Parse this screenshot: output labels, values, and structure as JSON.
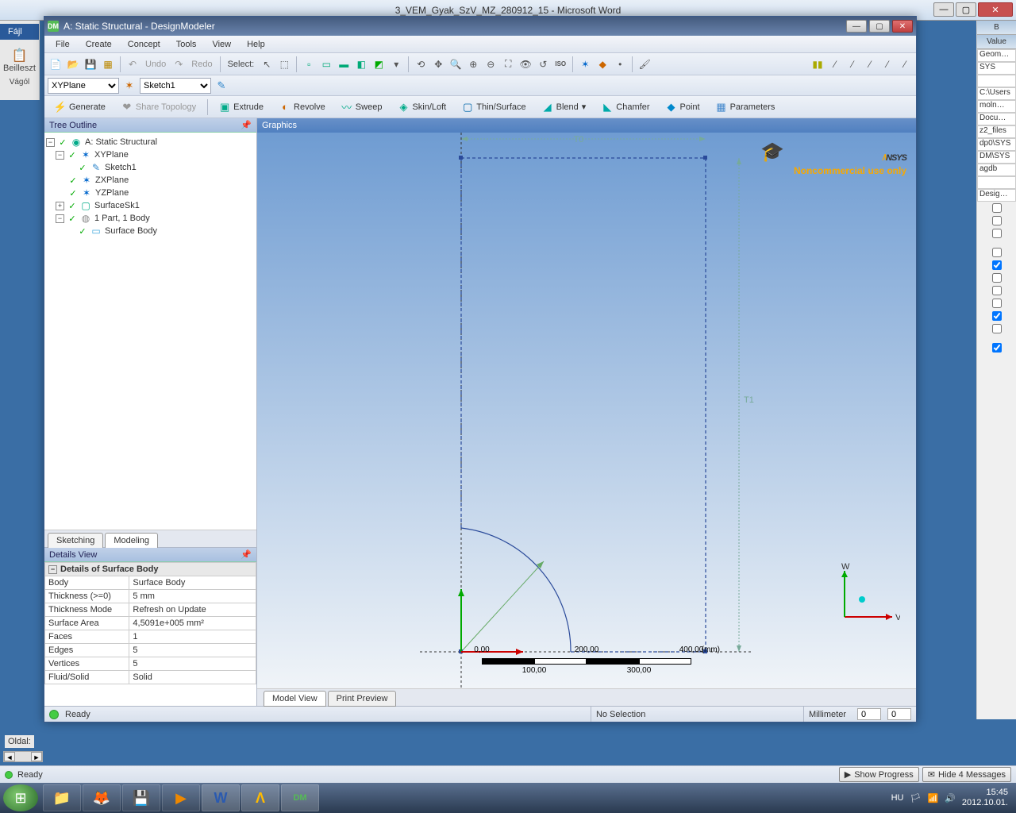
{
  "word": {
    "title": "3_VEM_Gyak_SzV_MZ_280912_15  - Microsoft Word",
    "file_tab": "Fájl",
    "paste": "Beilleszt",
    "vagol": "Vágól",
    "oldal": "Oldal: "
  },
  "wb_right": {
    "colB": "B",
    "value": "Value",
    "rows": [
      "Geom…",
      "SYS",
      "",
      "C:\\Users",
      "moln…",
      "Docu…",
      "z2_files",
      "dp0\\SYS",
      "DM\\SYS",
      "agdb",
      "",
      "Desig…"
    ]
  },
  "dm": {
    "title": "A: Static Structural - DesignModeler",
    "menu": [
      "File",
      "Create",
      "Concept",
      "Tools",
      "View",
      "Help"
    ],
    "toolbar1": {
      "undo": "Undo",
      "redo": "Redo",
      "select": "Select:"
    },
    "toolbar2": {
      "plane": "XYPlane",
      "sketch": "Sketch1"
    },
    "ops": {
      "generate": "Generate",
      "share": "Share Topology",
      "extrude": "Extrude",
      "revolve": "Revolve",
      "sweep": "Sweep",
      "skin": "Skin/Loft",
      "thin": "Thin/Surface",
      "blend": "Blend",
      "chamfer": "Chamfer",
      "point": "Point",
      "params": "Parameters"
    },
    "tree_hd": "Tree Outline",
    "tree": {
      "root": "A: Static Structural",
      "xyplane": "XYPlane",
      "sketch1": "Sketch1",
      "zxplane": "ZXPlane",
      "yzplane": "YZPlane",
      "surfacesk1": "SurfaceSk1",
      "part": "1 Part, 1 Body",
      "surfbody": "Surface Body"
    },
    "tabs": {
      "sketching": "Sketching",
      "modeling": "Modeling"
    },
    "details_hd": "Details View",
    "details": {
      "section": "Details of Surface Body",
      "rows": [
        [
          "Body",
          "Surface Body"
        ],
        [
          "Thickness (>=0)",
          "5 mm"
        ],
        [
          "Thickness Mode",
          "Refresh on Update"
        ],
        [
          "Surface Area",
          "4,5091e+005 mm²"
        ],
        [
          "Faces",
          "1"
        ],
        [
          "Edges",
          "5"
        ],
        [
          "Vertices",
          "5"
        ],
        [
          "Fluid/Solid",
          "Solid"
        ]
      ]
    },
    "graphics_hd": "Graphics",
    "logo_sub": "Noncommercial use only",
    "dim_t0": "T0",
    "dim_t1": "T1",
    "ruler": {
      "t0": "0,00",
      "t200": "200,00",
      "t400": "400,00",
      "b100": "100,00",
      "b300": "300,00",
      "unit": "(mm)"
    },
    "triad": {
      "x": "V",
      "y": "W"
    },
    "bottom_tabs": {
      "model": "Model View",
      "print": "Print Preview"
    },
    "status": {
      "ready": "Ready",
      "nosel": "No Selection",
      "unit": "Millimeter",
      "v1": "0",
      "v2": "0"
    }
  },
  "wb_status": {
    "ready": "Ready",
    "show": "Show Progress",
    "hide": "Hide 4 Messages"
  },
  "taskbar": {
    "lang": "HU",
    "time": "15:45",
    "date": "2012.10.01."
  }
}
